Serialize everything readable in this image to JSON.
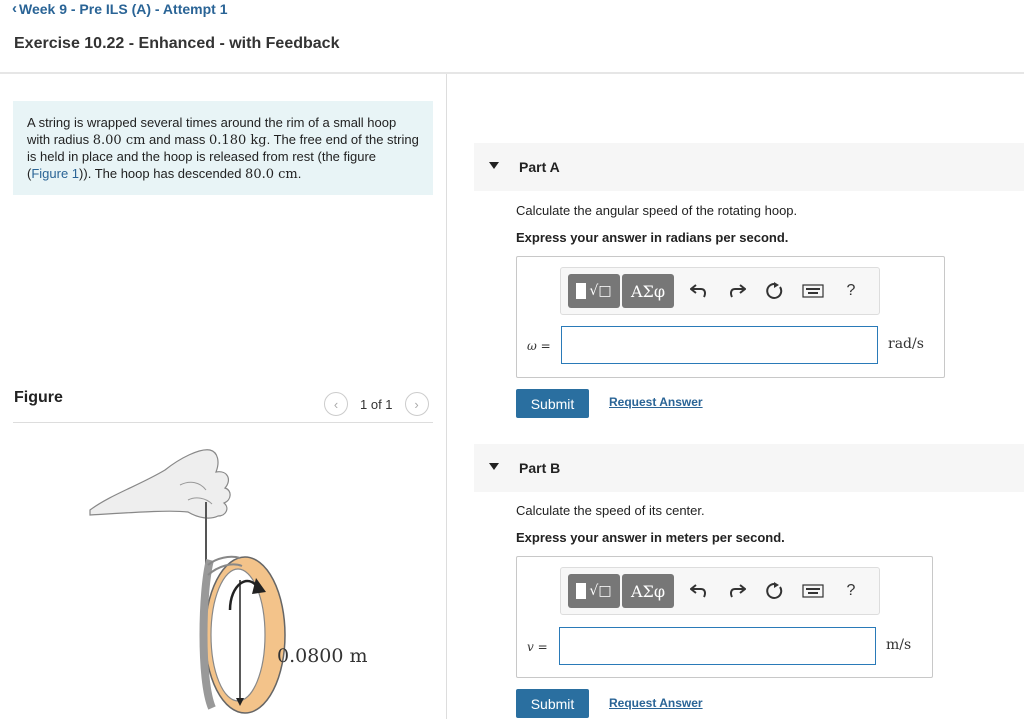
{
  "header": {
    "back_label": "Week 9 - Pre ILS (A) - Attempt 1",
    "title": "Exercise 10.22 - Enhanced - with Feedback"
  },
  "problem": {
    "t1": "A string is wrapped several times around the rim of a small hoop with radius ",
    "radius": "8.00 cm",
    "t2": " and mass ",
    "mass": "0.180 kg",
    "t3": ". The free end of the string is held in place and the hoop is released from rest (the figure (",
    "fig_link": "Figure 1",
    "t4": ")). The hoop has descended ",
    "descent": "80.0 cm",
    "t5": "."
  },
  "figure": {
    "label": "Figure",
    "pager_count": "1 of 1",
    "dimension_label": "0.0800 m"
  },
  "toolbar": {
    "greek_label": "ΑΣφ",
    "help_label": "?",
    "templates_icon": "templates-icon",
    "undo_icon": "undo-icon",
    "redo_icon": "redo-icon",
    "reset_icon": "reset-icon",
    "keyboard_icon": "keyboard-icon"
  },
  "parts": [
    {
      "title": "Part A",
      "question": "Calculate the angular speed of the rotating hoop.",
      "instruction": "Express your answer in radians per second.",
      "variable": "ω =",
      "unit": "rad/s",
      "value": "",
      "submit_label": "Submit",
      "request_label": "Request Answer"
    },
    {
      "title": "Part B",
      "question": "Calculate the speed of its center.",
      "instruction": "Express your answer in meters per second.",
      "variable": "v =",
      "unit": "m/s",
      "value": "",
      "submit_label": "Submit",
      "request_label": "Request Answer"
    }
  ],
  "colors": {
    "accent": "#2a6fa0",
    "link": "#2a6496",
    "problem_bg": "#e8f4f6",
    "hoop": "#f3c38a"
  }
}
